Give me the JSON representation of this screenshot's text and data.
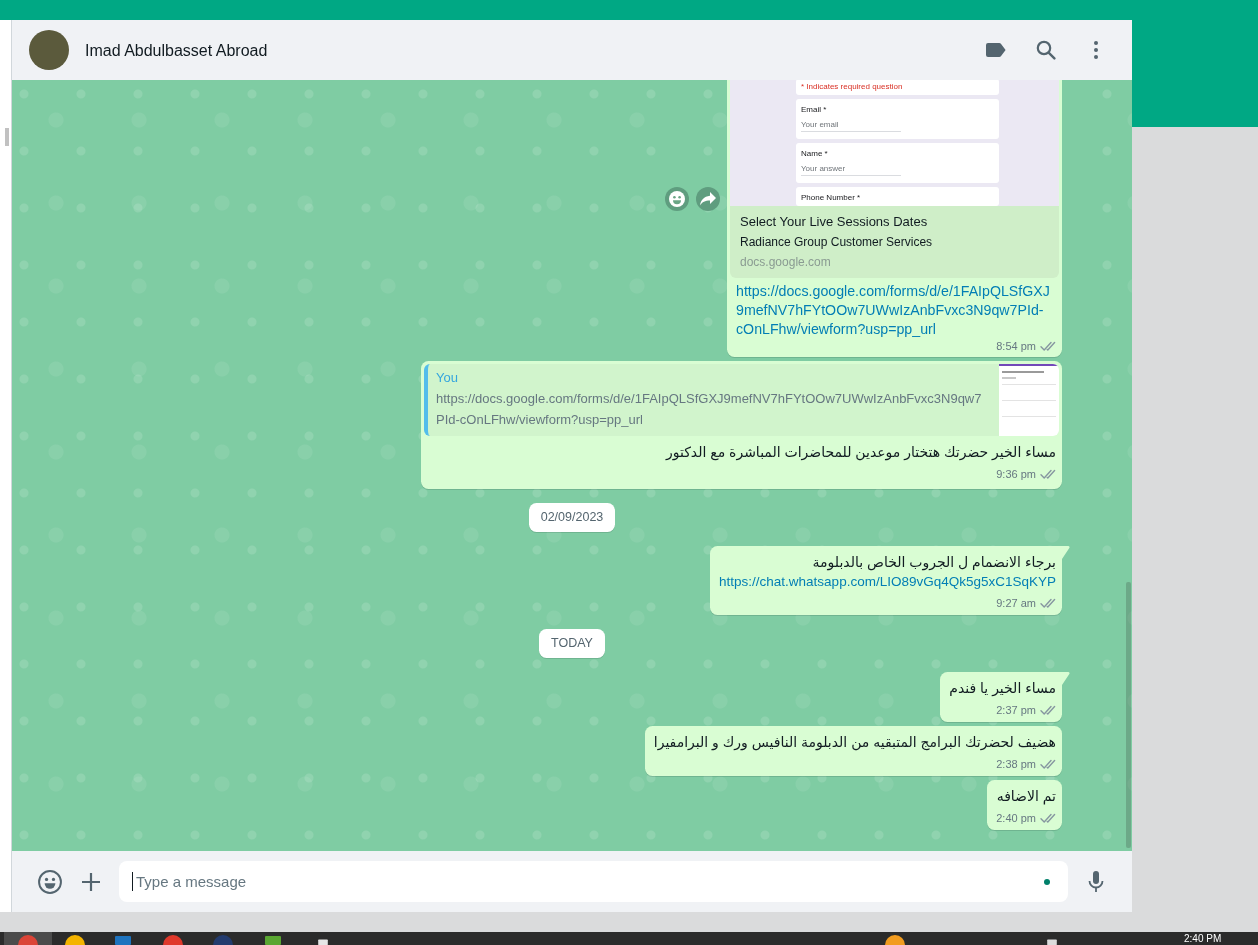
{
  "chat_header": {
    "contact_name": "Imad Abdulbasset Abroad"
  },
  "messages": [
    {
      "kind": "link_preview",
      "tail": false,
      "hover_actions": true,
      "preview": {
        "form": {
          "notice": "* Indicates required question",
          "fields": [
            {
              "label": "Email *",
              "placeholder": "Your email"
            },
            {
              "label": "Name *",
              "placeholder": "Your answer"
            },
            {
              "label": "Phone Number *"
            }
          ]
        },
        "title": "Select Your Live Sessions Dates",
        "description": "Radiance Group Customer Services",
        "domain": "docs.google.com"
      },
      "link": "https://docs.google.com/forms/d/e/1FAIpQLSfGXJ9mefNV7hFYtOOw7UWwIzAnbFvxc3N9qw7PId-cOnLFhw/viewform?usp=pp_url",
      "time": "8:54 pm",
      "read": false
    },
    {
      "kind": "reply",
      "tail": false,
      "hover_actions": false,
      "quote": {
        "author": "You",
        "text": "https://docs.google.com/forms/d/e/1FAIpQLSfGXJ9mefNV7hFYtOOw7UWwIzAnbFvxc3N9qw7PId-cOnLFhw/viewform?usp=pp_url"
      },
      "text": "مساء الخير حضرتك هتختار موعدين للمحاضرات المباشرة مع الدكتور",
      "time": "9:36 pm",
      "read": false
    },
    {
      "kind": "date",
      "label": "02/09/2023"
    },
    {
      "kind": "text",
      "tail": true,
      "hover_actions": false,
      "text": "برجاء الانضمام ل الجروب الخاص بالدبلومة",
      "link": "https://chat.whatsapp.com/LIO89vGq4Qk5g5xC1SqKYP",
      "time": "9:27 am",
      "read": false
    },
    {
      "kind": "date",
      "label": "TODAY"
    },
    {
      "kind": "text",
      "tail": true,
      "hover_actions": false,
      "text": "مساء الخير يا فندم",
      "time": "2:37 pm",
      "read": false
    },
    {
      "kind": "text",
      "tail": false,
      "hover_actions": false,
      "text": "هضيف لحضرتك البرامج المتبقيه من الدبلومة النافيس ورك و البرامفيرا",
      "time": "2:38 pm",
      "read": false
    },
    {
      "kind": "text",
      "tail": false,
      "hover_actions": false,
      "text": "تم الاضافه",
      "time": "2:40 pm",
      "read": false
    }
  ],
  "composer": {
    "placeholder": "Type a message",
    "focused": true
  },
  "taskbar": {
    "clock": "2:40 PM"
  }
}
